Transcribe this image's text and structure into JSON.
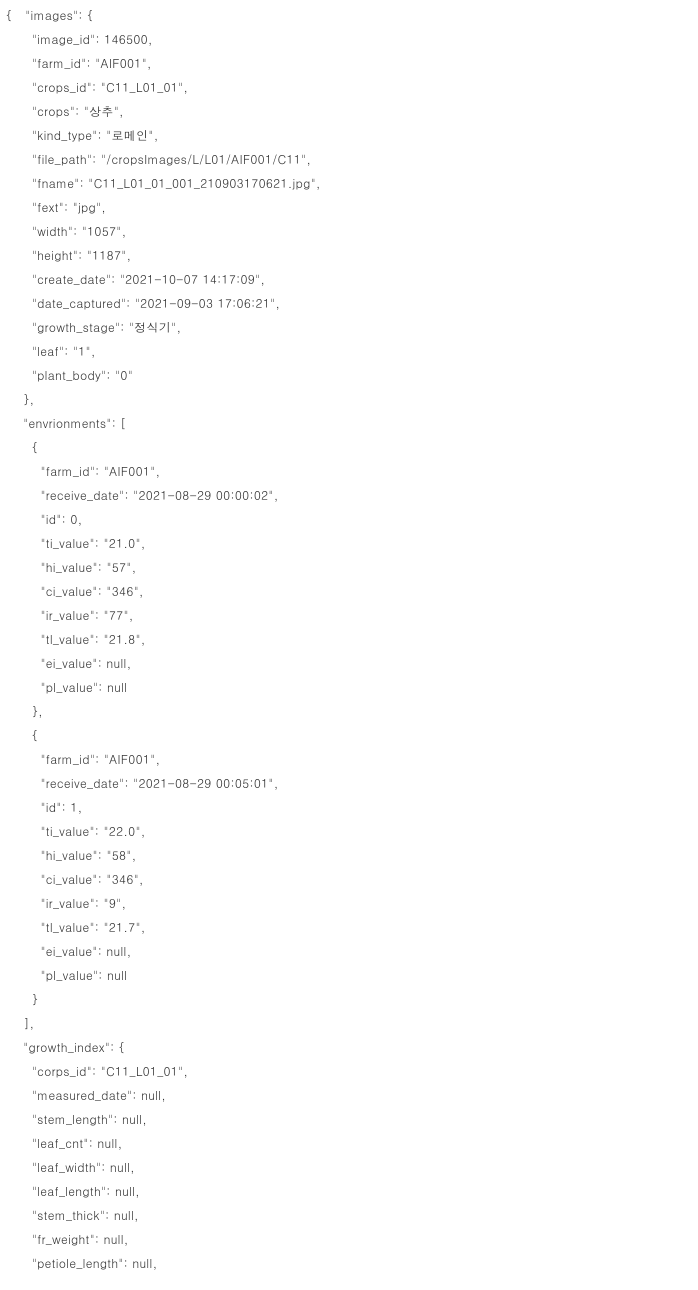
{
  "lines": [
    "{   \"images\": {",
    "      \"image_id\": 146500,",
    "      \"farm_id\": \"AIF001\",",
    "      \"crops_id\": \"C11_L01_01\",",
    "      \"crops\": \"상추\",",
    "      \"kind_type\": \"로메인\",",
    "      \"file_path\": \"/cropsImages/L/L01/AIF001/C11\",",
    "      \"fname\": \"C11_L01_01_001_210903170621.jpg\",",
    "      \"fext\": \"jpg\",",
    "      \"width\": \"1057\",",
    "      \"height\": \"1187\",",
    "      \"create_date\": \"2021-10-07 14:17:09\",",
    "      \"date_captured\": \"2021-09-03 17:06:21\",",
    "      \"growth_stage\": \"정식기\",",
    "      \"leaf\": \"1\",",
    "      \"plant_body\": \"0\"",
    "    },",
    "    \"envrionments\": [",
    "      {",
    "        \"farm_id\": \"AIF001\",",
    "        \"receive_date\": \"2021-08-29 00:00:02\",",
    "        \"id\": 0,",
    "        \"ti_value\": \"21.0\",",
    "        \"hi_value\": \"57\",",
    "        \"ci_value\": \"346\",",
    "        \"ir_value\": \"77\",",
    "        \"tl_value\": \"21.8\",",
    "        \"ei_value\": null,",
    "        \"pl_value\": null",
    "      },",
    "      {",
    "        \"farm_id\": \"AIF001\",",
    "        \"receive_date\": \"2021-08-29 00:05:01\",",
    "        \"id\": 1,",
    "        \"ti_value\": \"22.0\",",
    "        \"hi_value\": \"58\",",
    "        \"ci_value\": \"346\",",
    "        \"ir_value\": \"9\",",
    "        \"tl_value\": \"21.7\",",
    "        \"ei_value\": null,",
    "        \"pl_value\": null",
    "      }",
    "    ],",
    "    \"growth_index\": {",
    "      \"corps_id\": \"C11_L01_01\",",
    "      \"measured_date\": null,",
    "      \"stem_length\": null,",
    "      \"leaf_cnt\": null,",
    "      \"leaf_width\": null,",
    "      \"leaf_length\": null,",
    "      \"stem_thick\": null,",
    "      \"fr_weight\": null,",
    "      \"petiole_length\": null,"
  ]
}
